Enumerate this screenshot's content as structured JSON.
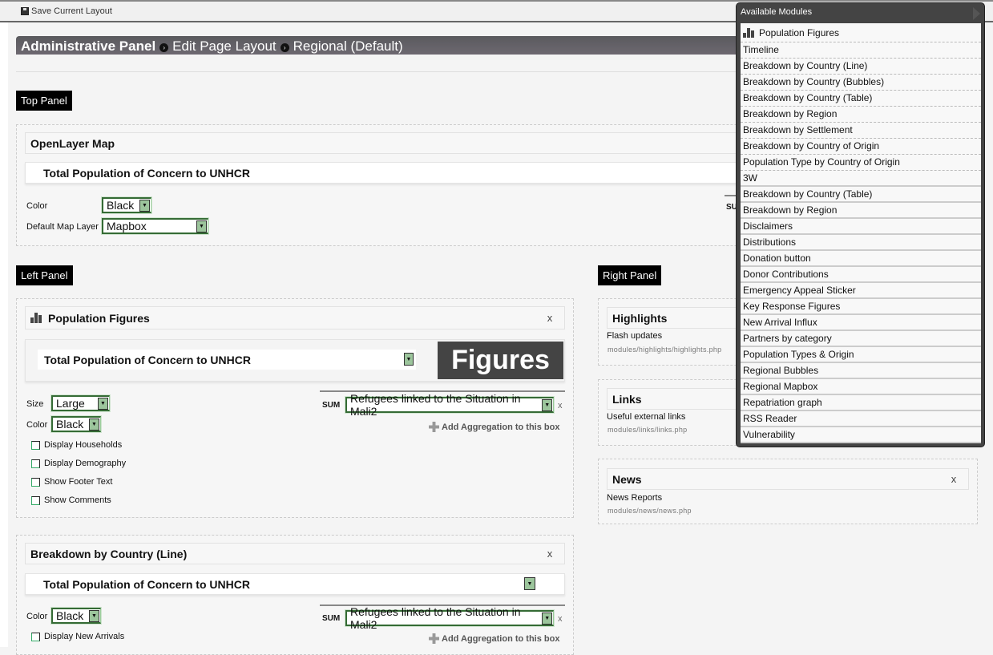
{
  "toolbar": {
    "save_label": "Save Current Layout"
  },
  "breadcrumb": {
    "root": "Administrative Panel",
    "page": "Edit Page Layout",
    "layout": "Regional (Default)"
  },
  "top_panel": {
    "label": "Top Panel",
    "module": {
      "title": "OpenLayer Map",
      "dataset": "Total Population of Concern to UNHCR",
      "color_label": "Color",
      "color_value": "Black",
      "map_layer_label": "Default Map Layer",
      "map_layer_value": "Mapbox",
      "sum_partial": "SU"
    }
  },
  "left_panel": {
    "label": "Left Panel",
    "modules": [
      {
        "title": "Population Figures",
        "close": "x",
        "dataset": "Total Population of Concern to UNHCR",
        "banner": "Figures",
        "size_label": "Size",
        "size_value": "Large",
        "color_label": "Color",
        "color_value": "Black",
        "checkboxes": [
          "Display Households",
          "Display Demography",
          "Show Footer Text",
          "Show Comments"
        ],
        "sum_label": "SUM",
        "aggregation": "Refugees linked to the Situation in Mali2",
        "remove": "x",
        "add_aggregation": "Add Aggregation to this box"
      },
      {
        "title": "Breakdown by Country (Line)",
        "close": "x",
        "dataset": "Total Population of Concern to UNHCR",
        "color_label": "Color",
        "color_value": "Black",
        "checkboxes": [
          "Display New Arrivals"
        ],
        "sum_label": "SUM",
        "aggregation": "Refugees linked to the Situation in Mali2",
        "remove": "x",
        "add_aggregation": "Add Aggregation to this box"
      }
    ]
  },
  "right_panel": {
    "label": "Right Panel",
    "modules": [
      {
        "title": "Highlights",
        "description": "Flash updates",
        "path": "modules/highlights/highlights.php"
      },
      {
        "title": "Links",
        "description": "Useful external links",
        "path": "modules/links/links.php"
      },
      {
        "title": "News",
        "close": "x",
        "description": "News Reports",
        "path": "modules/news/news.php"
      }
    ]
  },
  "available_modules": {
    "title": "Available Modules",
    "items": [
      "Population Figures",
      "Timeline",
      "Breakdown by Country (Line)",
      "Breakdown by Country (Bubbles)",
      "Breakdown by Country (Table)",
      "Breakdown by Region",
      "Breakdown by Settlement",
      "Breakdown by Country of Origin",
      "Population Type by Country of Origin",
      "3W",
      "Breakdown by Country (Table)",
      "Breakdown by Region",
      "Disclaimers",
      "Distributions",
      "Donation button",
      "Donor Contributions",
      "Emergency Appeal Sticker",
      "Key Response Figures",
      "New Arrival Influx",
      "Partners by category",
      "Population Types & Origin",
      "Regional Bubbles",
      "Regional Mapbox",
      "Repatriation graph",
      "RSS Reader",
      "Vulnerability"
    ]
  }
}
